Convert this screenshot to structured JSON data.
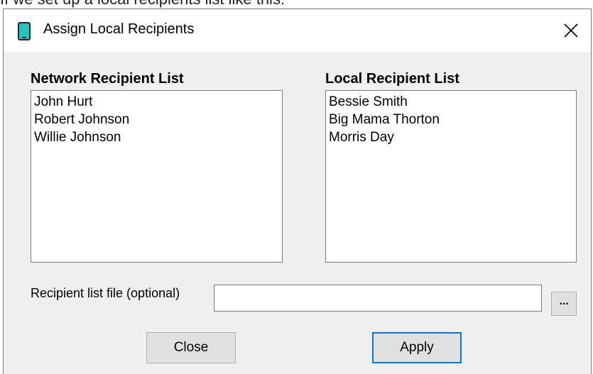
{
  "caption": "If we set up a local recipients list like this:",
  "window": {
    "title": "Assign Local Recipients",
    "icon": "tablet-icon",
    "close_glyph": "✕"
  },
  "network_list": {
    "label": "Network Recipient List",
    "items": [
      "John Hurt",
      "Robert Johnson",
      "Willie Johnson"
    ]
  },
  "local_list": {
    "label": "Local Recipient List",
    "items": [
      "Bessie Smith",
      "Big Mama Thorton",
      "Morris Day"
    ]
  },
  "file_field": {
    "label": "Recipient list file (optional)",
    "value": "",
    "browse_label": "..."
  },
  "buttons": {
    "close_label": "Close",
    "apply_label": "Apply"
  },
  "colors": {
    "accent": "#0078d7",
    "icon_fill": "#1ec6c2",
    "dialog_bg": "#f0f0f0"
  }
}
